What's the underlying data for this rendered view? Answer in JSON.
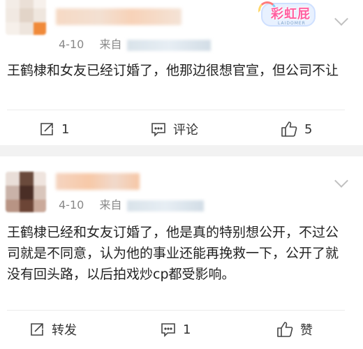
{
  "post1": {
    "date": "4-10",
    "source_label": "来自",
    "content": "王鹤棣和女友已经订婚了，他那边很想官宣，但公司不让",
    "actions": {
      "repost": "1",
      "comment": "评论",
      "like": "5"
    },
    "badge": {
      "text": "彩虹屁",
      "subtext": "LAIDOMER"
    }
  },
  "post2": {
    "date": "4-10",
    "source_label": "来自",
    "content": "王鹤棣已经和女友订婚了，他是真的特别想公开，不过公司就是不同意，认为他的事业还能再挽救一下，公开了就没有回头路，以后拍戏炒cp都受影响。",
    "actions": {
      "repost": "转发",
      "comment": "1",
      "like": "赞"
    }
  },
  "colors": {
    "background": "#f2f2f2",
    "card": "#ffffff",
    "meta_text": "#888888",
    "badge_pink": "#ff5fa0"
  }
}
